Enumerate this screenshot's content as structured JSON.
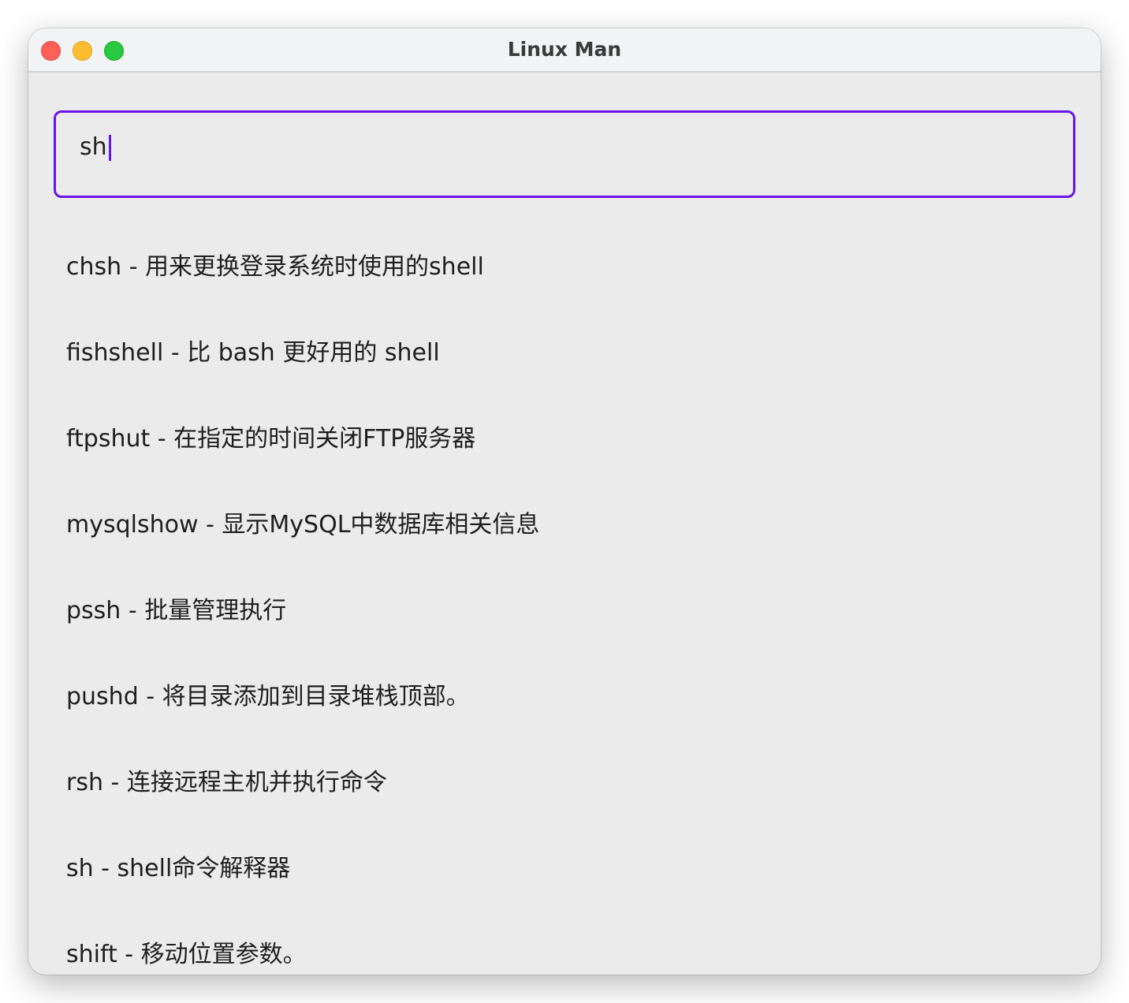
{
  "window": {
    "title": "Linux Man"
  },
  "search": {
    "value": "sh",
    "accent_color": "#6a14e8"
  },
  "results": [
    "chsh - 用来更换登录系统时使用的shell",
    "fishshell - 比 bash 更好用的 shell",
    "ftpshut - 在指定的时间关闭FTP服务器",
    "mysqlshow - 显示MySQL中数据库相关信息",
    "pssh - 批量管理执行",
    "pushd - 将目录添加到目录堆栈顶部。",
    "rsh - 连接远程主机并执行命令",
    "sh - shell命令解释器",
    "shift - 移动位置参数。"
  ]
}
